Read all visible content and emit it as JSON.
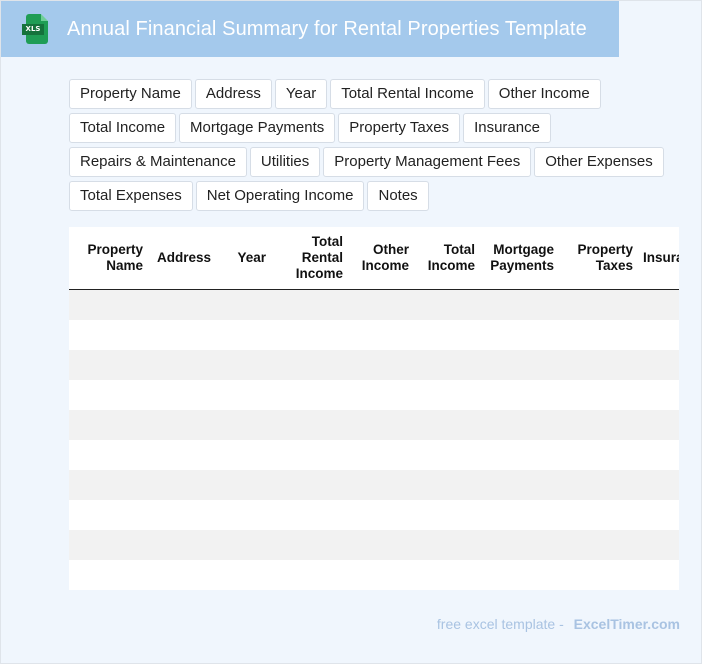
{
  "header": {
    "icon": "xls-file-icon",
    "icon_label": "XLS",
    "title": "Annual Financial Summary for Rental Properties Template"
  },
  "fields": [
    "Property Name",
    "Address",
    "Year",
    "Total Rental Income",
    "Other Income",
    "Total Income",
    "Mortgage Payments",
    "Property Taxes",
    "Insurance",
    "Repairs & Maintenance",
    "Utilities",
    "Property Management Fees",
    "Other Expenses",
    "Total Expenses",
    "Net Operating Income",
    "Notes"
  ],
  "table": {
    "columns": [
      "Property Name",
      "Address",
      "Year",
      "Total Rental Income",
      "Other Income",
      "Total Income",
      "Mortgage Payments",
      "Property Taxes",
      "Insurance"
    ],
    "empty_row_count": 10
  },
  "footer": {
    "text": "free excel template -",
    "brand": "ExcelTimer.com"
  },
  "colors": {
    "title_bar": "#a4c9ec",
    "page_background": "#f0f6fd",
    "stripe": "#f2f2f2",
    "footer_text": "#a9c3e2"
  }
}
